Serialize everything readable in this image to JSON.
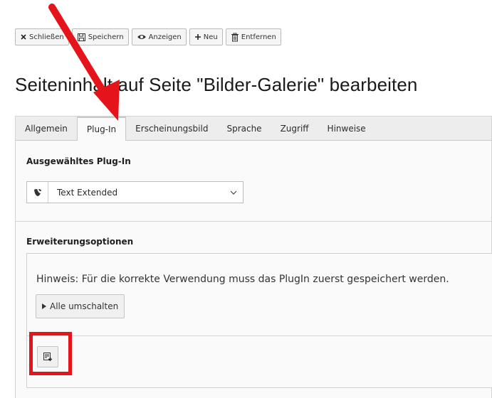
{
  "toolbar": {
    "close_label": "Schließen",
    "save_label": "Speichern",
    "view_label": "Anzeigen",
    "new_label": "Neu",
    "delete_label": "Entfernen"
  },
  "page": {
    "title": "Seiteninhalt auf Seite \"Bilder-Galerie\" bearbeiten"
  },
  "tabs": [
    {
      "label": "Allgemein",
      "active": false
    },
    {
      "label": "Plug-In",
      "active": true
    },
    {
      "label": "Erscheinungsbild",
      "active": false
    },
    {
      "label": "Sprache",
      "active": false
    },
    {
      "label": "Zugriff",
      "active": false
    },
    {
      "label": "Hinweise",
      "active": false
    }
  ],
  "plugin": {
    "section_label": "Ausgewähltes Plug-In",
    "selected_value": "Text Extended",
    "icon": "typo3-logo-icon"
  },
  "options": {
    "section_label": "Erweiterungsoptionen",
    "hint": "Hinweis: Für die korrekte Verwendung muss das PlugIn zuerst gespeichert werden.",
    "toggle_label": "Alle umschalten",
    "add_icon": "add-record-icon"
  },
  "annotations": {
    "color": "#e5141b",
    "arrow_target": "tab-plug-in",
    "highlight_target": "add-record-button"
  }
}
